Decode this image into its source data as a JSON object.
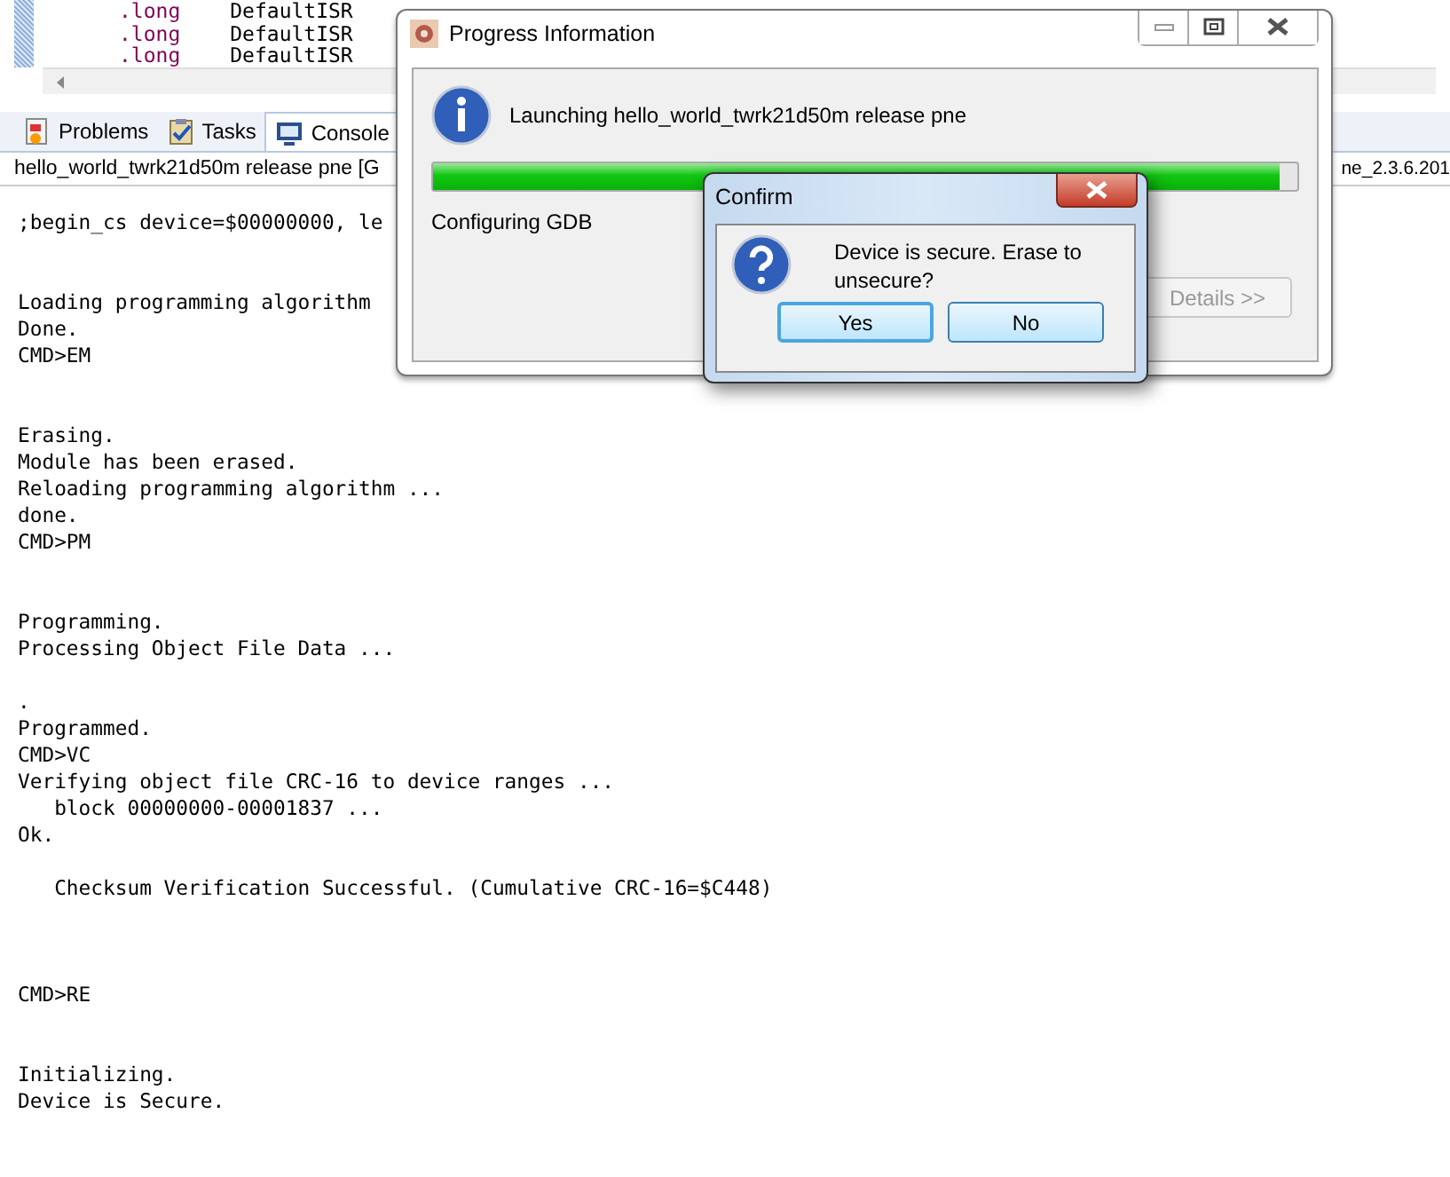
{
  "editor": {
    "lines": [
      {
        "keyword": ".long",
        "value": "DefaultISR"
      },
      {
        "keyword": ".long",
        "value": "DefaultISR"
      },
      {
        "keyword": ".long",
        "value": "DefaultISR"
      }
    ]
  },
  "tabs": [
    {
      "label": "Problems",
      "selected": false
    },
    {
      "label": "Tasks",
      "selected": false
    },
    {
      "label": "Console",
      "selected": true
    }
  ],
  "console": {
    "header": "hello_world_twrk21d50m release pne [G",
    "header_right": "ne_2.3.6.201",
    "lines": [
      {
        "kind": "text",
        "text": ";begin_cs device=$00000000, le"
      },
      {
        "kind": "blank"
      },
      {
        "kind": "blank"
      },
      {
        "kind": "text",
        "text": "Loading programming algorithm"
      },
      {
        "kind": "text",
        "text": "Done."
      },
      {
        "kind": "text",
        "text": "CMD>EM"
      },
      {
        "kind": "blank"
      },
      {
        "kind": "blank"
      },
      {
        "kind": "text",
        "text": "Erasing."
      },
      {
        "kind": "text",
        "text": "Module has been erased."
      },
      {
        "kind": "text",
        "text": "Reloading programming algorithm ..."
      },
      {
        "kind": "text",
        "text": "done."
      },
      {
        "kind": "text",
        "text": "CMD>PM"
      },
      {
        "kind": "blank"
      },
      {
        "kind": "blank"
      },
      {
        "kind": "text",
        "text": "Programming."
      },
      {
        "kind": "text",
        "text": "Processing Object File Data ..."
      },
      {
        "kind": "blank"
      },
      {
        "kind": "text",
        "text": "."
      },
      {
        "kind": "text",
        "text": "Programmed."
      },
      {
        "kind": "text",
        "text": "CMD>VC"
      },
      {
        "kind": "text",
        "text": "Verifying object file CRC-16 to device ranges ..."
      },
      {
        "kind": "text",
        "text": "   block 00000000-00001837 ..."
      },
      {
        "kind": "text",
        "text": "Ok."
      },
      {
        "kind": "blank"
      },
      {
        "kind": "text",
        "text": "   Checksum Verification Successful. (Cumulative CRC-16=$C448)"
      },
      {
        "kind": "blank"
      },
      {
        "kind": "blank"
      },
      {
        "kind": "blank"
      },
      {
        "kind": "text",
        "text": "CMD>RE"
      },
      {
        "kind": "blank"
      },
      {
        "kind": "blank"
      },
      {
        "kind": "text",
        "text": "Initializing."
      },
      {
        "kind": "text",
        "text": "Device is Secure."
      }
    ]
  },
  "progress_dialog": {
    "title": "Progress Information",
    "message": "Launching hello_world_twrk21d50m release pne",
    "level": 0.98,
    "status": "Configuring GDB",
    "details_button": {
      "label": "Details >>",
      "disabled": true
    }
  },
  "confirm_dialog": {
    "title": "Confirm",
    "message": "Device is secure. Erase to unsecure?",
    "buttons": [
      {
        "label": "Yes",
        "focused": true
      },
      {
        "label": "No",
        "focused": false
      }
    ]
  }
}
